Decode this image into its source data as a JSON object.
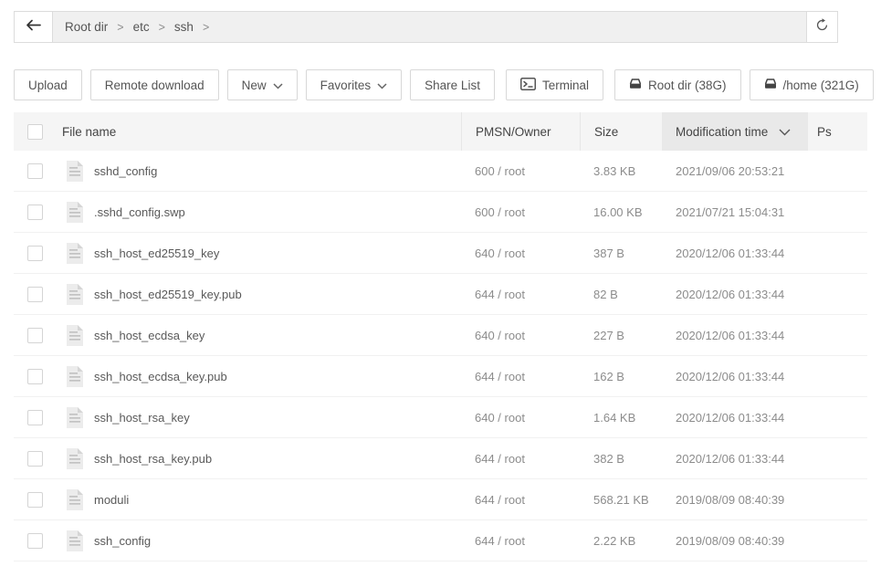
{
  "topbar": {
    "breadcrumb": [
      {
        "label": "Root dir"
      },
      {
        "label": "etc"
      },
      {
        "label": "ssh"
      }
    ],
    "separator": ">"
  },
  "toolbar": {
    "upload_label": "Upload",
    "remote_download_label": "Remote download",
    "new_label": "New",
    "favorites_label": "Favorites",
    "share_list_label": "Share List",
    "terminal_label": "Terminal",
    "root_disk_label": "Root dir (38G)",
    "home_disk_label": "/home (321G)"
  },
  "table": {
    "columns": {
      "name": "File name",
      "pmsn": "PMSN/Owner",
      "size": "Size",
      "mtime": "Modification time",
      "ps": "Ps"
    },
    "sorted_column": "mtime",
    "rows": [
      {
        "name": "sshd_config",
        "pmsn": "600 / root",
        "size": "3.83 KB",
        "mtime": "2021/09/06 20:53:21",
        "ps": ""
      },
      {
        "name": ".sshd_config.swp",
        "pmsn": "600 / root",
        "size": "16.00 KB",
        "mtime": "2021/07/21 15:04:31",
        "ps": ""
      },
      {
        "name": "ssh_host_ed25519_key",
        "pmsn": "640 / root",
        "size": "387 B",
        "mtime": "2020/12/06 01:33:44",
        "ps": ""
      },
      {
        "name": "ssh_host_ed25519_key.pub",
        "pmsn": "644 / root",
        "size": "82 B",
        "mtime": "2020/12/06 01:33:44",
        "ps": ""
      },
      {
        "name": "ssh_host_ecdsa_key",
        "pmsn": "640 / root",
        "size": "227 B",
        "mtime": "2020/12/06 01:33:44",
        "ps": ""
      },
      {
        "name": "ssh_host_ecdsa_key.pub",
        "pmsn": "644 / root",
        "size": "162 B",
        "mtime": "2020/12/06 01:33:44",
        "ps": ""
      },
      {
        "name": "ssh_host_rsa_key",
        "pmsn": "640 / root",
        "size": "1.64 KB",
        "mtime": "2020/12/06 01:33:44",
        "ps": ""
      },
      {
        "name": "ssh_host_rsa_key.pub",
        "pmsn": "644 / root",
        "size": "382 B",
        "mtime": "2020/12/06 01:33:44",
        "ps": ""
      },
      {
        "name": "moduli",
        "pmsn": "644 / root",
        "size": "568.21 KB",
        "mtime": "2019/08/09 08:40:39",
        "ps": ""
      },
      {
        "name": "ssh_config",
        "pmsn": "644 / root",
        "size": "2.22 KB",
        "mtime": "2019/08/09 08:40:39",
        "ps": ""
      }
    ]
  },
  "icons": {
    "back": "arrow-left",
    "refresh": "refresh",
    "new_menu": "chevron-down",
    "favorites_menu": "chevron-down",
    "terminal": "terminal-window",
    "root_disk": "hard-drive",
    "home_disk": "hard-drive",
    "sort_indicator": "chevron-down",
    "file_row": "document"
  },
  "colors": {
    "breadcrumb_bg": "#f0f0f0",
    "header_bg": "#f5f5f5",
    "sorted_col_bg": "#e9e9e9",
    "border": "#dcdcdc",
    "muted_text": "#8c8c8c"
  }
}
